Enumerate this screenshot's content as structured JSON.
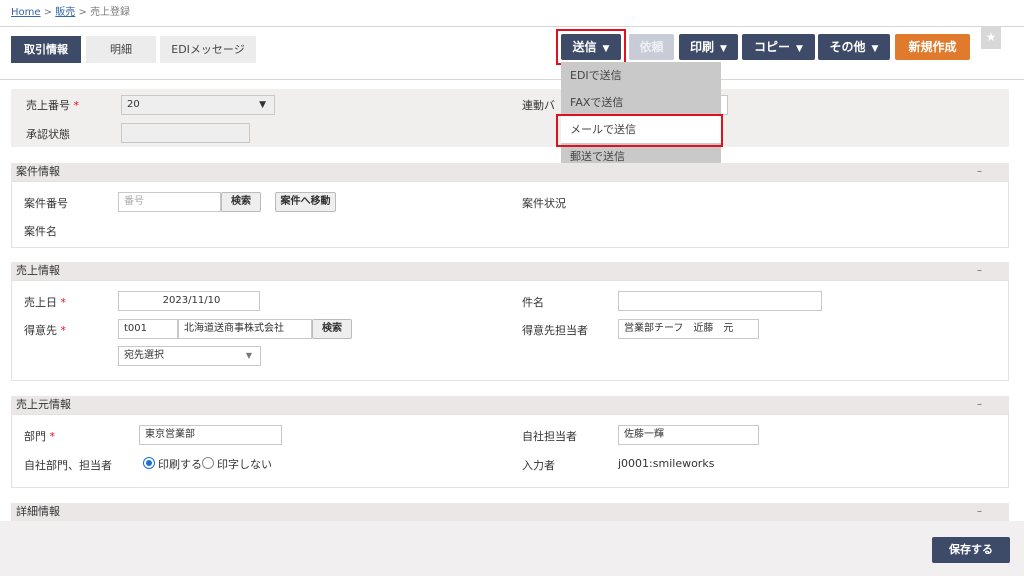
{
  "breadcrumb": {
    "home": "Home",
    "sep1": ">",
    "sales": "販売",
    "sep2": ">",
    "current": "売上登録"
  },
  "tabs": [
    "取引情報",
    "明細",
    "EDIメッセージ"
  ],
  "toolbar": {
    "send": "送信",
    "request": "依頼",
    "print": "印刷",
    "copy": "コピー",
    "other": "その他",
    "new": "新規作成",
    "star_icon": "star-icon"
  },
  "send_menu": {
    "items": [
      "EDIで送信",
      "FAXで送信",
      "メールで送信",
      "郵送で送信"
    ]
  },
  "header_fields": {
    "sales_no_label": "売上番号",
    "required_mark": "*",
    "sales_no_value": "20",
    "approval_label": "承認状態",
    "link_label": "連動バ"
  },
  "case_section": {
    "title": "案件情報",
    "collapse": "–",
    "case_no_label": "案件番号",
    "case_no_placeholder": "番号",
    "search": "検索",
    "goto_case": "案件へ移動",
    "case_status_label": "案件状況",
    "case_name_label": "案件名"
  },
  "sales_section": {
    "title": "売上情報",
    "collapse": "–",
    "date_label": "売上日",
    "date_value": "2023/11/10",
    "subject_label": "件名",
    "subject_value": "",
    "customer_label": "得意先",
    "customer_code": "t001",
    "customer_name": "北海道送商事株式会社",
    "search": "検索",
    "customer_contact_label": "得意先担当者",
    "customer_contact_value": "営業部チーフ　近藤　元",
    "destination_select": "宛先選択"
  },
  "source_section": {
    "title": "売上元情報",
    "collapse": "–",
    "dept_label": "部門",
    "dept_value": "東京営業部",
    "staff_label": "自社担当者",
    "staff_value": "佐藤一輝",
    "print_label": "自社部門、担当者",
    "print_yes": "印刷する",
    "print_no": "印字しない",
    "entry_label": "入力者",
    "entry_value": "j0001:smileworks"
  },
  "detail_section": {
    "title": "詳細情報",
    "collapse": "–"
  },
  "footer": {
    "save": "保存する"
  }
}
